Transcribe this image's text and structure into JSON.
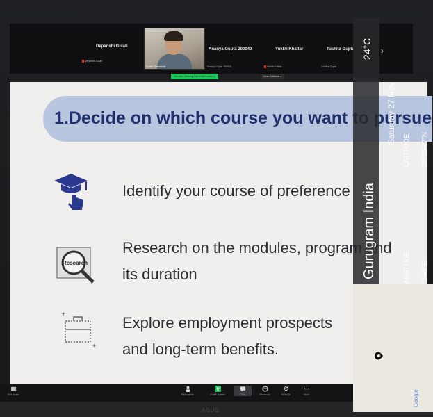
{
  "gallery": {
    "participants": [
      {
        "name": "Depanshi Gulati",
        "subtitle": "Depanshi Gulati"
      },
      {
        "name": "Ananya Gupta 200040",
        "subtitle": "Ananya Gupta 200040"
      },
      {
        "name": "Yukkti Khattar",
        "subtitle": "Yukkti Khattar"
      },
      {
        "name": "Tushita Gupta",
        "subtitle": "Tushita Gupta"
      }
    ],
    "video_label": "Sumit Sehrawat",
    "viewing_banner": "You are viewing Harshita's screen",
    "view_options": "View Options ⌄",
    "next_arrow": "›"
  },
  "slide": {
    "heading": "1.Decide on which course you want to pursue",
    "bullets": [
      {
        "icon": "graduation-cap-pointer-icon",
        "line1": "Identify your course of preference",
        "line2": ""
      },
      {
        "icon": "research-magnifier-icon",
        "line1": "Research on the modules, program and",
        "line2": "its duration"
      },
      {
        "icon": "briefcase-icon",
        "line1": "Explore employment prospects",
        "line2": "and long-term benefits."
      }
    ],
    "research_icon_text": "Research"
  },
  "toolbar": {
    "left_label": "End Share",
    "items": [
      "Participants",
      "Share Screen",
      "Chat",
      "Reactions",
      "Settings",
      "More"
    ]
  },
  "gps_overlay": {
    "temperature": "24°C",
    "date": "Saturday 27 Nov",
    "location": "Gurugram India",
    "latitude_label": "LATITUDE",
    "latitude_value": "28°25'47\"N",
    "longitude_label": "LONGITUDE",
    "longitude_value": "77°2'49\"E",
    "map_brand": "Google"
  },
  "monitor": {
    "brand": "ASUS"
  },
  "colors": {
    "heading_bar": "#b9c6e0",
    "heading_text": "#1e2f6b",
    "viewing_banner": "#23c35e"
  }
}
